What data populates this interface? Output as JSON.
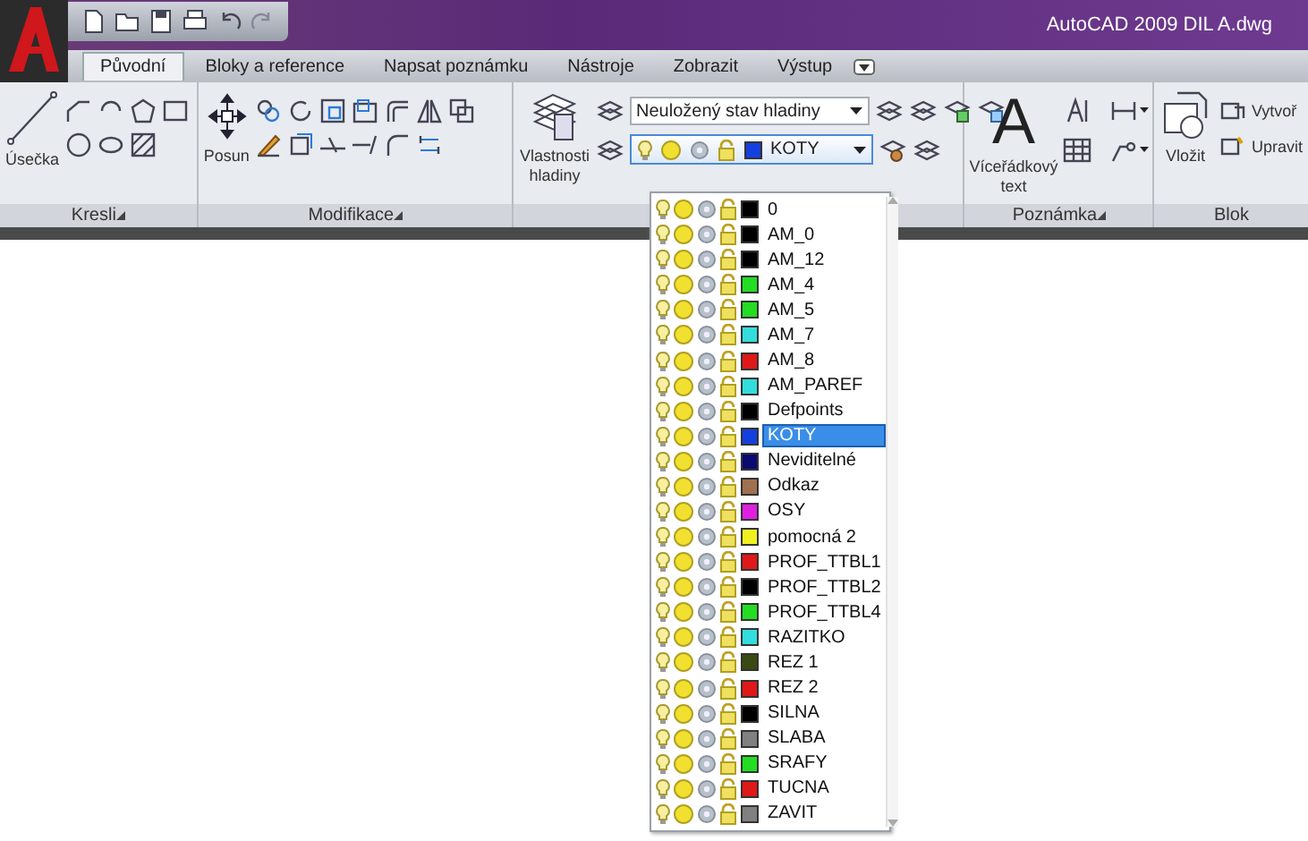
{
  "window": {
    "title": "AutoCAD 2009 DIL A.dwg"
  },
  "tabs": [
    {
      "label": "Původní",
      "selected": true
    },
    {
      "label": "Bloky a reference",
      "selected": false
    },
    {
      "label": "Napsat poznámku",
      "selected": false
    },
    {
      "label": "Nástroje",
      "selected": false
    },
    {
      "label": "Zobrazit",
      "selected": false
    },
    {
      "label": "Výstup",
      "selected": false
    }
  ],
  "panels": {
    "draw": {
      "title": "Kresli",
      "big_button": "Úsečka"
    },
    "modify": {
      "title": "Modifikace",
      "big_button": "Posun"
    },
    "layers": {
      "big_button": "Vlastnosti hladiny",
      "layer_state": "Neuložený stav hladiny",
      "current_layer": {
        "name": "KOTY",
        "color": "#1540e0"
      }
    },
    "annotation": {
      "title": "Poznámka",
      "big_glyph": "A",
      "big_button": "Víceřádkový text"
    },
    "block": {
      "title": "Blok",
      "big_button": "Vložit",
      "create": "Vytvoř",
      "edit": "Upravit"
    }
  },
  "layer_list": [
    {
      "name": "0",
      "color": "#000000",
      "selected": false
    },
    {
      "name": "AM_0",
      "color": "#000000",
      "selected": false
    },
    {
      "name": "AM_12",
      "color": "#000000",
      "selected": false
    },
    {
      "name": "AM_4",
      "color": "#22dd22",
      "selected": false
    },
    {
      "name": "AM_5",
      "color": "#22dd22",
      "selected": false
    },
    {
      "name": "AM_7",
      "color": "#33dddd",
      "selected": false
    },
    {
      "name": "AM_8",
      "color": "#e01818",
      "selected": false
    },
    {
      "name": "AM_PAREF",
      "color": "#33dddd",
      "selected": false
    },
    {
      "name": "Defpoints",
      "color": "#000000",
      "selected": false
    },
    {
      "name": "KOTY",
      "color": "#1540e0",
      "selected": true
    },
    {
      "name": "Neviditelné",
      "color": "#0a0a70",
      "selected": false
    },
    {
      "name": "Odkaz",
      "color": "#a07050",
      "selected": false
    },
    {
      "name": "OSY",
      "color": "#e020e0",
      "selected": false
    },
    {
      "name": "pomocná 2",
      "color": "#f0f020",
      "selected": false
    },
    {
      "name": "PROF_TTBL1",
      "color": "#e01818",
      "selected": false
    },
    {
      "name": "PROF_TTBL2",
      "color": "#000000",
      "selected": false
    },
    {
      "name": "PROF_TTBL4",
      "color": "#22dd22",
      "selected": false
    },
    {
      "name": "RAZITKO",
      "color": "#33dddd",
      "selected": false
    },
    {
      "name": "REZ 1",
      "color": "#3a4a10",
      "selected": false
    },
    {
      "name": "REZ 2",
      "color": "#e01818",
      "selected": false
    },
    {
      "name": "SILNA",
      "color": "#000000",
      "selected": false
    },
    {
      "name": "SLABA",
      "color": "#808080",
      "selected": false
    },
    {
      "name": "SRAFY",
      "color": "#22dd22",
      "selected": false
    },
    {
      "name": "TUCNA",
      "color": "#e01818",
      "selected": false
    },
    {
      "name": "ZAVIT",
      "color": "#808080",
      "selected": false
    }
  ]
}
